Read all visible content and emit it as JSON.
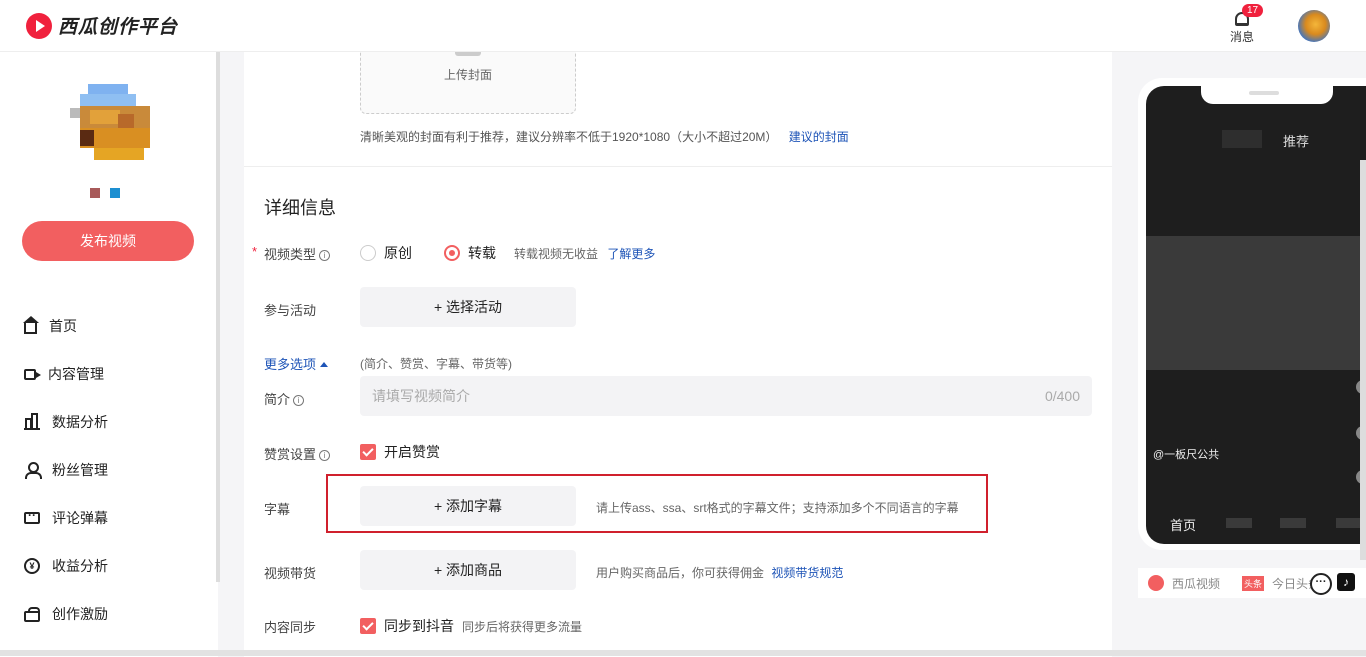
{
  "app": {
    "logo_text": "西瓜创作平台"
  },
  "header": {
    "message_label": "消息",
    "message_count": "17"
  },
  "sidebar": {
    "publish_label": "发布视频",
    "items": [
      {
        "label": "首页",
        "icon": "home-icon"
      },
      {
        "label": "内容管理",
        "icon": "video-icon"
      },
      {
        "label": "数据分析",
        "icon": "chart-icon"
      },
      {
        "label": "粉丝管理",
        "icon": "fans-icon"
      },
      {
        "label": "评论弹幕",
        "icon": "comment-icon"
      },
      {
        "label": "收益分析",
        "icon": "money-icon"
      },
      {
        "label": "创作激励",
        "icon": "gift-icon"
      }
    ]
  },
  "cover": {
    "upload_label": "上传封面",
    "hint": "清晰美观的封面有利于推荐，建议分辨率不低于1920*1080（大小不超过20M）",
    "hint_link": "建议的封面"
  },
  "details": {
    "title": "详细信息",
    "video_type": {
      "label": "视频类型",
      "options": [
        "原创",
        "转载"
      ],
      "selected": "转载",
      "note": "转载视频无收益",
      "note_link": "了解更多"
    },
    "activity": {
      "label": "参与活动",
      "button": "+ 选择活动"
    },
    "more_options": {
      "label": "更多选项",
      "hint": "(简介、赞赏、字幕、带货等)"
    },
    "intro": {
      "label": "简介",
      "placeholder": "请填写视频简介",
      "counter": "0/400"
    },
    "reward": {
      "label": "赞赏设置",
      "checkbox": "开启赞赏",
      "checked": true
    },
    "subtitle": {
      "label": "字幕",
      "button": "+ 添加字幕",
      "hint": "请上传ass、ssa、srt格式的字幕文件；支持添加多个不同语言的字幕"
    },
    "goods": {
      "label": "视频带货",
      "button": "+ 添加商品",
      "hint": "用户购买商品后，你可获得佣金",
      "hint_link": "视频带货规范"
    },
    "sync": {
      "label": "内容同步",
      "checkbox": "同步到抖音",
      "checked": true,
      "hint": "同步后将获得更多流量"
    }
  },
  "preview": {
    "tab": "推荐",
    "author": "@一板尺公共",
    "nav_home": "首页"
  },
  "platforms": {
    "xigua": "西瓜视频",
    "toutiao_badge": "头条",
    "toutiao": "今日头条"
  },
  "colors": {
    "accent": "#f25f60",
    "link": "#1e54b7",
    "highlight_border": "#d0202d"
  }
}
